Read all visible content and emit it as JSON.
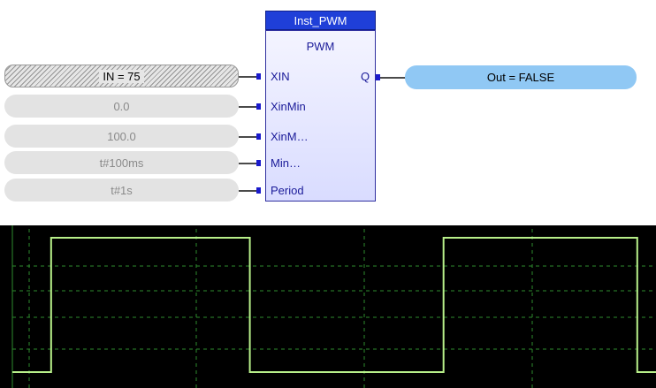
{
  "block": {
    "instance_name": "Inst_PWM",
    "type_name": "PWM",
    "inputs": [
      "XIN",
      "XinMin",
      "XinM…",
      "Min…",
      "Period"
    ],
    "output": "Q"
  },
  "input_values": [
    "IN = 75",
    "0.0",
    "100.0",
    "t#100ms",
    "t#1s"
  ],
  "output_value": "Out = FALSE",
  "colors": {
    "block_header": "#1f3fd8",
    "pin": "#1a1acc",
    "output_pill": "#90c8f4",
    "scope_bg": "#000000",
    "scope_trace": "#b8f08a",
    "scope_grid": "#2e8b2e"
  },
  "chart_data": {
    "type": "line",
    "title": "",
    "xlabel": "",
    "ylabel": "",
    "grid": true,
    "series": [
      {
        "values_description_free": true,
        "x": [
          0,
          0.62,
          0.62,
          3.8,
          3.8,
          6.9,
          6.9,
          6.9,
          7.3,
          10.0,
          10.0,
          10.3
        ],
        "y": [
          0,
          0,
          1,
          1,
          0,
          0,
          0,
          1,
          1,
          1,
          0,
          0
        ]
      }
    ],
    "xlim": [
      0,
      10.3
    ],
    "ylim": [
      0,
      1
    ]
  }
}
